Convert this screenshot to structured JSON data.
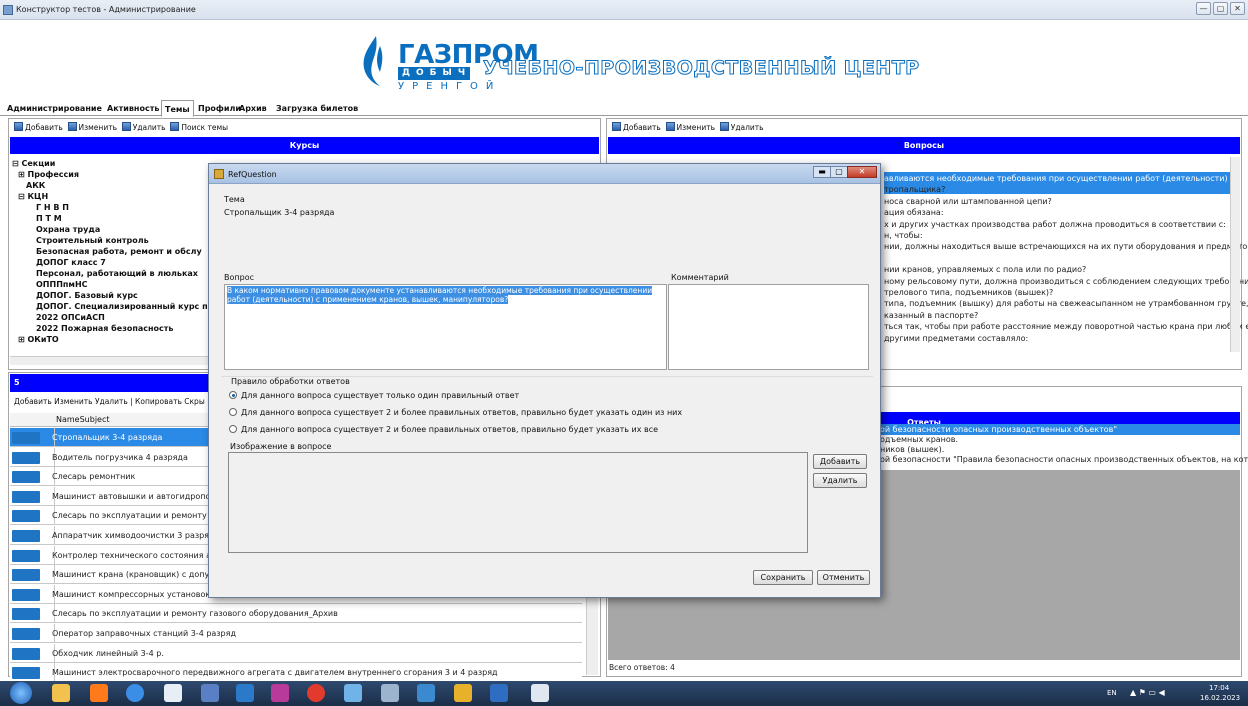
{
  "window": {
    "title": "Конструктор тестов - Администрирование",
    "controls": [
      "—",
      "▢",
      "✕"
    ]
  },
  "banner": {
    "logo_main": "ГАЗПРОМ",
    "logo_sub1": "ДОБЫЧА",
    "logo_sub2": "УРЕНГОЙ",
    "center_title": "УЧЕБНО-ПРОИЗВОДСТВЕННЫЙ ЦЕНТР",
    "brand_color": "#0a6fbf"
  },
  "main_tabs": [
    "Администрирование",
    "Активность",
    "Темы",
    "Профили",
    "Архив",
    "Загрузка билетов"
  ],
  "active_tab": "Темы",
  "left_toolbar": {
    "add": "Добавить",
    "edit": "Изменить",
    "delete": "Удалить",
    "search": "Поиск темы"
  },
  "courses_header": "Курсы",
  "tree": [
    {
      "label": "Секции",
      "prefix": "⊟"
    },
    {
      "label": "Профессия",
      "prefix": "⊞"
    },
    {
      "label": "АКК",
      "prefix": ""
    },
    {
      "label": "КЦН",
      "prefix": "⊟"
    },
    {
      "label": "Г Н В П",
      "prefix": ""
    },
    {
      "label": "П Т М",
      "prefix": ""
    },
    {
      "label": "Охрана труда",
      "prefix": ""
    },
    {
      "label": "Строительный контроль",
      "prefix": ""
    },
    {
      "label": "Безопасная работа, ремонт и обслу",
      "prefix": ""
    },
    {
      "label": "ДОПОГ класс 7",
      "prefix": ""
    },
    {
      "label": "Персонал, работающий в люльках",
      "prefix": ""
    },
    {
      "label": "ОПППпмНС",
      "prefix": ""
    },
    {
      "label": "ДОПОГ. Базовый курс",
      "prefix": ""
    },
    {
      "label": "ДОПОГ. Специализированный курс п",
      "prefix": ""
    },
    {
      "label": "2022 ОПСиАСП",
      "prefix": ""
    },
    {
      "label": "2022 Пожарная безопасность",
      "prefix": ""
    },
    {
      "label": "ОКиТО",
      "prefix": "⊞"
    }
  ],
  "subjects_panel": {
    "header": "5",
    "toolbar": "Добавить  Изменить  Удалить  |  Копировать  Скры",
    "column": "NameSubject",
    "rows": [
      "Стропальщик 3-4 разряда",
      "Водитель погрузчика 4 разряда",
      "Слесарь ремонтник",
      "Машинист автовышки и автогидроподъёмн",
      "Слесарь по эксплуатации и ремонту газов",
      "Аппаратчик химводоочистки 3 разряд",
      "Контролер технического состояния авто",
      "Машинист крана (крановщик) с допуском",
      "Машинист компрессорных установок",
      "Слесарь по эксплуатации и ремонту газового оборудования_Архив",
      "Оператор заправочных станций 3-4 разряд",
      "Обходчик линейный 3-4 р.",
      "Машинист электросварочного передвижного агрегата с двигателем внутреннего сгорания 3 и 4 разряд"
    ]
  },
  "right_toolbar": {
    "add": "Добавить",
    "edit": "Изменить",
    "delete": "Удалить"
  },
  "questions_header": "Вопросы",
  "questions_columns": [
    "Нпп",
    "NameQuestion"
  ],
  "questions_visible": [
    "авливаются необходимые требования при осуществлении работ (деятельности) с",
    "тропальщика?",
    "носа сварной или штампованной цепи?",
    "ация обязана:",
    "х и других участках производства работ должна проводиться в соответствии с:",
    "н, чтобы:",
    "нии, должны находиться выше встречающихся на их пути оборудования и предметов не",
    "",
    "нии кранов, управляемых с пола или по радио?",
    "ному рельсовому пути, должна производиться с соблюдением следующих требований:",
    "трелового типа, подъемников (вышек)?",
    " типа, подъемник (вышку) для работы на свежеасыпанном не утрамбованном грунте, а",
    "казанный в паспорте?",
    "ться так, чтобы при работе расстояние между поворотной частью крана при любом его",
    "другими предметами составляло:"
  ],
  "answers_header": "Ответы",
  "answers_visible": [
    "ой безопасности опасных производственных объектов\"",
    "одъемных кранов.",
    "ников (вышек).",
    "ой безопасности \"Правила безопасности опасных производственных объектов, на которых"
  ],
  "answers_total": "Всего ответов: 4",
  "dialog": {
    "title": "RefQuestion",
    "theme_label": "Тема",
    "theme_value": "Стропальщик 3-4 разряда",
    "question_label": "Вопрос",
    "question_value": "В каком нормативно правовом документе устанавливаются необходимые требования при осуществлении работ (деятельности) с применением кранов, вышек, манипуляторов?",
    "comment_label": "Комментарий",
    "rule_label": "Правило обработки ответов",
    "rules": [
      "Для данного вопроса существует только один правильный ответ",
      "Для данного вопроса существует 2 и более правильных ответов, правильно будет указать один из них",
      "Для данного вопроса существует 2 и более правильных ответов, правильно будет указать их все"
    ],
    "rule_selected": 0,
    "image_label": "Изображение в вопросе",
    "image_add": "Добавить",
    "image_delete": "Удалить",
    "save": "Сохранить",
    "cancel": "Отменить"
  },
  "taskbar": {
    "lang": "EN",
    "time": "17:04",
    "date": "16.02.2023"
  },
  "colors": {
    "header_blue": "#0000ff",
    "selection": "#2a8ae6",
    "grid_gray": "#a7a7a7"
  }
}
